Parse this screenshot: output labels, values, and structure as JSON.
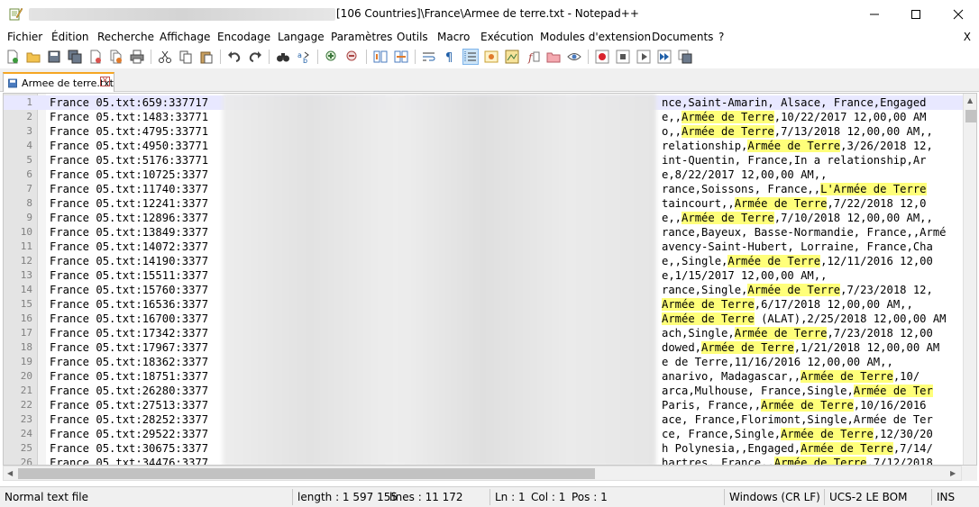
{
  "window": {
    "title": "[106 Countries]\\France\\Armee de terre.txt - Notepad++",
    "close_symbol": "X"
  },
  "menu": [
    "Fichier",
    "Édition",
    "Recherche",
    "Affichage",
    "Encodage",
    "Langage",
    "Paramètres",
    "Outils",
    "Macro",
    "Exécution",
    "Modules d'extension",
    "Documents",
    "?"
  ],
  "tab": {
    "label": "Armee de terre.txt"
  },
  "editor": {
    "lines": [
      {
        "n": "1",
        "left": "France 05.txt:659:337717",
        "right": [
          [
            "nce,Saint-Amarin, Alsace, France,Engaged",
            0
          ]
        ]
      },
      {
        "n": "2",
        "left": "France 05.txt:1483:33771",
        "right": [
          [
            "e,,",
            0
          ],
          [
            "Armée de Terre",
            1
          ],
          [
            ",10/22/2017 12,00,00 AM",
            0
          ]
        ]
      },
      {
        "n": "3",
        "left": "France 05.txt:4795:33771",
        "right": [
          [
            "o,,",
            0
          ],
          [
            "Armée de Terre",
            1
          ],
          [
            ",7/13/2018 12,00,00 AM,,",
            0
          ]
        ]
      },
      {
        "n": "4",
        "left": "France 05.txt:4950:33771",
        "right": [
          [
            "relationship,",
            0
          ],
          [
            "Armée de Terre",
            1
          ],
          [
            ",3/26/2018 12,",
            0
          ]
        ]
      },
      {
        "n": "5",
        "left": "France 05.txt:5176:33771",
        "right": [
          [
            "int-Quentin, France,In a relationship,Ar",
            0
          ]
        ]
      },
      {
        "n": "6",
        "left": "France 05.txt:10725:3377",
        "right": [
          [
            "e,8/22/2017 12,00,00 AM,,",
            0
          ]
        ]
      },
      {
        "n": "7",
        "left": "France 05.txt:11740:3377",
        "right": [
          [
            "rance,Soissons, France,,",
            0
          ],
          [
            "L'Armée de Terre",
            1
          ]
        ]
      },
      {
        "n": "8",
        "left": "France 05.txt:12241:3377",
        "right": [
          [
            "taincourt,,",
            0
          ],
          [
            "Armée de Terre",
            1
          ],
          [
            ",7/22/2018 12,0",
            0
          ]
        ]
      },
      {
        "n": "9",
        "left": "France 05.txt:12896:3377",
        "right": [
          [
            "e,,",
            0
          ],
          [
            "Armée de Terre",
            1
          ],
          [
            ",7/10/2018 12,00,00 AM,,",
            0
          ]
        ]
      },
      {
        "n": "10",
        "left": "France 05.txt:13849:3377",
        "right": [
          [
            "rance,Bayeux, Basse-Normandie, France,,Armé",
            0
          ]
        ]
      },
      {
        "n": "11",
        "left": "France 05.txt:14072:3377",
        "right": [
          [
            "avency-Saint-Hubert, Lorraine, France,Cha",
            0
          ]
        ]
      },
      {
        "n": "12",
        "left": "France 05.txt:14190:3377",
        "right": [
          [
            "e,,Single,",
            0
          ],
          [
            "Armée de Terre",
            1
          ],
          [
            ",12/11/2016 12,00",
            0
          ]
        ]
      },
      {
        "n": "13",
        "left": "France 05.txt:15511:3377",
        "right": [
          [
            "e,1/15/2017 12,00,00 AM,,",
            0
          ]
        ]
      },
      {
        "n": "14",
        "left": "France 05.txt:15760:3377",
        "right": [
          [
            "rance,Single,",
            0
          ],
          [
            "Armée de Terre",
            1
          ],
          [
            ",7/23/2018 12,",
            0
          ]
        ]
      },
      {
        "n": "15",
        "left": "France 05.txt:16536:3377",
        "right": [
          [
            "",
            0
          ],
          [
            "Armée de Terre",
            1
          ],
          [
            ",6/17/2018 12,00,00 AM,,",
            0
          ]
        ]
      },
      {
        "n": "16",
        "left": "France 05.txt:16700:3377",
        "right": [
          [
            "",
            0
          ],
          [
            "Armée de Terre",
            1
          ],
          [
            " (ALAT),2/25/2018 12,00,00 AM",
            0
          ]
        ]
      },
      {
        "n": "17",
        "left": "France 05.txt:17342:3377",
        "right": [
          [
            "ach,Single,",
            0
          ],
          [
            "Armée de Terre",
            1
          ],
          [
            ",7/23/2018 12,00",
            0
          ]
        ]
      },
      {
        "n": "18",
        "left": "France 05.txt:17967:3377",
        "right": [
          [
            "dowed,",
            0
          ],
          [
            "Armée de Terre",
            1
          ],
          [
            ",1/21/2018 12,00,00 AM",
            0
          ]
        ]
      },
      {
        "n": "19",
        "left": "France 05.txt:18362:3377",
        "right": [
          [
            "e de Terre,11/16/2016 12,00,00 AM,,",
            0
          ]
        ]
      },
      {
        "n": "20",
        "left": "France 05.txt:18751:3377",
        "right": [
          [
            "anarivo, Madagascar,,",
            0
          ],
          [
            "Armée de Terre",
            1
          ],
          [
            ",10/",
            0
          ]
        ]
      },
      {
        "n": "21",
        "left": "France 05.txt:26280:3377",
        "right": [
          [
            "arca,Mulhouse, France,Single,",
            0
          ],
          [
            "Armée de Ter",
            1
          ]
        ]
      },
      {
        "n": "22",
        "left": "France 05.txt:27513:3377",
        "right": [
          [
            "Paris, France,,",
            0
          ],
          [
            "Armée de Terre",
            1
          ],
          [
            ",10/16/2016",
            0
          ]
        ]
      },
      {
        "n": "23",
        "left": "France 05.txt:28252:3377",
        "right": [
          [
            "ace, France,Florimont,Single,Armée de Ter",
            0
          ]
        ]
      },
      {
        "n": "24",
        "left": "France 05.txt:29522:3377",
        "right": [
          [
            "ce, France,Single,",
            0
          ],
          [
            "Armée de Terre",
            1
          ],
          [
            ",12/30/20",
            0
          ]
        ]
      },
      {
        "n": "25",
        "left": "France 05.txt:30675:3377",
        "right": [
          [
            "h Polynesia,,Engaged,",
            0
          ],
          [
            "Armée de Terre",
            1
          ],
          [
            ",7/14/",
            0
          ]
        ]
      },
      {
        "n": "26",
        "left": "France 05.txt:34476:3377",
        "right": [
          [
            "hartres, France,,",
            0
          ],
          [
            "Armée de Terre",
            1
          ],
          [
            ",7/12/2018",
            0
          ]
        ]
      }
    ]
  },
  "status": {
    "type": "Normal text file",
    "length": "length : 1 597 155",
    "lines": "lines : 11 172",
    "ln": "Ln : 1",
    "col": "Col : 1",
    "pos": "Pos : 1",
    "eol": "Windows (CR LF)",
    "encoding": "UCS-2 LE BOM",
    "mode": "INS"
  },
  "colors": {
    "highlight": "#ffff7a",
    "tab_accent": "#f5a623",
    "current_line": "#e8e8ff"
  }
}
